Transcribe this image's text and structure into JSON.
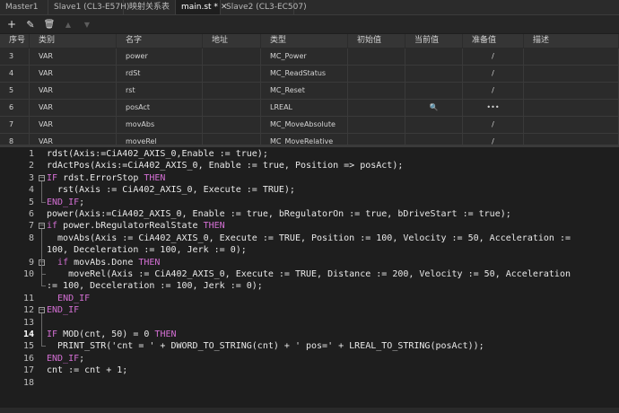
{
  "tabs": [
    {
      "label": "Master1",
      "active": false
    },
    {
      "label": "Slave1 (CL3-E57H)",
      "active": false
    },
    {
      "label": "映射关系表",
      "active": false
    },
    {
      "label": "main.st *",
      "active": true,
      "closable": true
    },
    {
      "label": "Slave2 (CL3-EC507)",
      "active": false
    }
  ],
  "toolbar": {
    "add_icon": "plus-icon",
    "edit_icon": "edit-icon",
    "delete_icon": "trash-icon",
    "up_icon": "arrow-up-icon",
    "down_icon": "arrow-down-icon",
    "add_glyph": "+",
    "edit_glyph": "✎",
    "delete_glyph": "🗑",
    "up_glyph": "▲",
    "down_glyph": "▼"
  },
  "var_table": {
    "columns": [
      "序号",
      "类别",
      "名字",
      "地址",
      "类型",
      "初始值",
      "当前值",
      "准备值",
      "描述"
    ],
    "rows": [
      {
        "no": "3",
        "cat": "VAR",
        "name": "power",
        "addr": "",
        "type": "MC_Power",
        "init": "",
        "cur": "",
        "prep": "/",
        "desc": ""
      },
      {
        "no": "4",
        "cat": "VAR",
        "name": "rdSt",
        "addr": "",
        "type": "MC_ReadStatus",
        "init": "",
        "cur": "",
        "prep": "/",
        "desc": ""
      },
      {
        "no": "5",
        "cat": "VAR",
        "name": "rst",
        "addr": "",
        "type": "MC_Reset",
        "init": "",
        "cur": "",
        "prep": "/",
        "desc": ""
      },
      {
        "no": "6",
        "cat": "VAR",
        "name": "posAct",
        "addr": "",
        "type": "LREAL",
        "init": "",
        "cur": "🔍",
        "prep": "•••",
        "desc": ""
      },
      {
        "no": "7",
        "cat": "VAR",
        "name": "movAbs",
        "addr": "",
        "type": "MC_MoveAbsolute",
        "init": "",
        "cur": "",
        "prep": "/",
        "desc": ""
      },
      {
        "no": "8",
        "cat": "VAR",
        "name": "moveRel",
        "addr": "",
        "type": "MC_MoveRelative",
        "init": "",
        "cur": "",
        "prep": "/",
        "desc": ""
      }
    ]
  },
  "editor": {
    "current_line": "14",
    "lines": [
      {
        "n": "1",
        "t": "rdst(Axis:=CiA402_AXIS_0,Enable := true);"
      },
      {
        "n": "2",
        "t": "rdActPos(Axis:=CiA402_AXIS_0, Enable := true, Position => posAct);"
      },
      {
        "n": "3",
        "t": "IF rdst.ErrorStop THEN"
      },
      {
        "n": "4",
        "t": "  rst(Axis := CiA402_AXIS_0, Execute := TRUE);"
      },
      {
        "n": "5",
        "t": "END_IF;"
      },
      {
        "n": "6",
        "t": "power(Axis:=CiA402_AXIS_0, Enable := true, bRegulatorOn := true, bDriveStart := true);"
      },
      {
        "n": "7",
        "t": "if power.bRegulatorRealState THEN"
      },
      {
        "n": "8",
        "t": "  movAbs(Axis := CiA402_AXIS_0, Execute := TRUE, Position := 100, Velocity := 50, Acceleration :="
      },
      {
        "n": "",
        "t": "100, Deceleration := 100, Jerk := 0);"
      },
      {
        "n": "9",
        "t": "  if movAbs.Done THEN"
      },
      {
        "n": "10",
        "t": "    moveRel(Axis := CiA402_AXIS_0, Execute := TRUE, Distance := 200, Velocity := 50, Acceleration"
      },
      {
        "n": "",
        "t": ":= 100, Deceleration := 100, Jerk := 0);"
      },
      {
        "n": "11",
        "t": "  END_IF"
      },
      {
        "n": "12",
        "t": "END_IF"
      },
      {
        "n": "13",
        "t": ""
      },
      {
        "n": "14",
        "t": "IF MOD(cnt, 50) = 0 THEN"
      },
      {
        "n": "15",
        "t": "  PRINT_STR('cnt = ' + DWORD_TO_STRING(cnt) + ' pos=' + LREAL_TO_STRING(posAct));"
      },
      {
        "n": "16",
        "t": "END_IF;"
      },
      {
        "n": "17",
        "t": "cnt := cnt + 1;"
      },
      {
        "n": "18",
        "t": ""
      }
    ]
  },
  "colors": {
    "keyword": "#d36fd3",
    "text": "#e8e8e8",
    "background": "#1e1e1e"
  }
}
